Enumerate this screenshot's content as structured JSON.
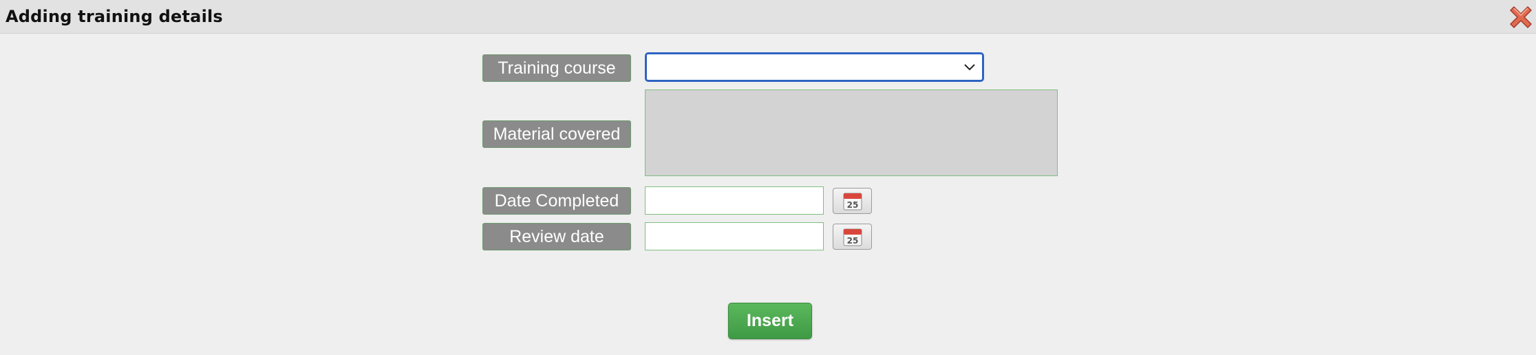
{
  "dialog": {
    "title": "Adding training details",
    "close_icon": "close-x-icon"
  },
  "form": {
    "training_course": {
      "label": "Training course",
      "selected_value": ""
    },
    "material_covered": {
      "label": "Material covered",
      "value": ""
    },
    "date_completed": {
      "label": "Date Completed",
      "value": "",
      "calendar_icon": "calendar-icon",
      "calendar_day": "25"
    },
    "review_date": {
      "label": "Review date",
      "value": "",
      "calendar_icon": "calendar-icon",
      "calendar_day": "25"
    }
  },
  "actions": {
    "insert_label": "Insert"
  },
  "colors": {
    "label_background": "#8a8b8a",
    "select_focus_border": "#2e63c2",
    "insert_button": "#4cae4c",
    "close_icon": "#d9534f"
  }
}
